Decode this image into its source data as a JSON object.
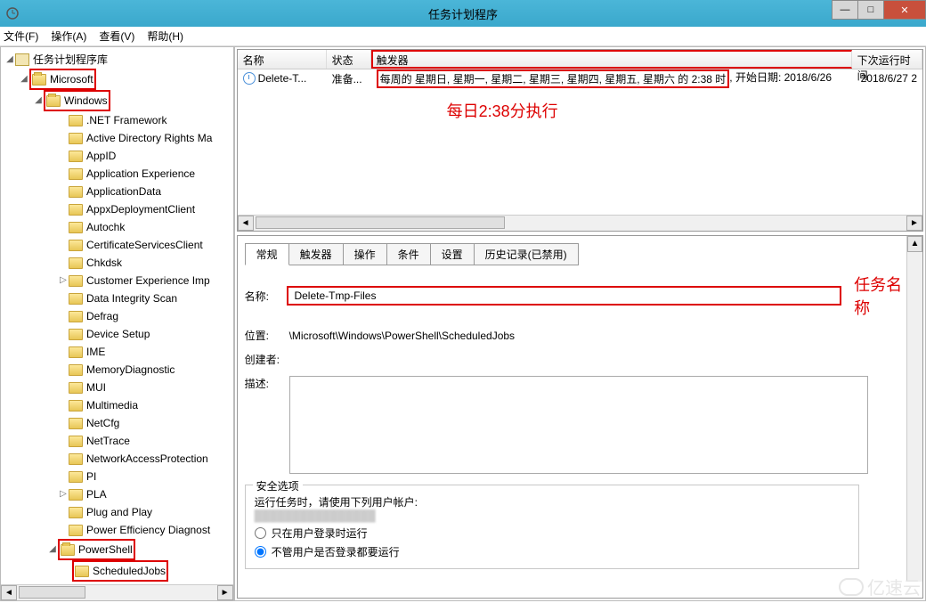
{
  "window": {
    "title": "任务计划程序"
  },
  "menu": {
    "file": "文件(F)",
    "action": "操作(A)",
    "view": "查看(V)",
    "help": "帮助(H)"
  },
  "tree": {
    "root": "任务计划程序库",
    "microsoft": "Microsoft",
    "windows": "Windows",
    "items": [
      ".NET Framework",
      "Active Directory Rights Ma",
      "AppID",
      "Application Experience",
      "ApplicationData",
      "AppxDeploymentClient",
      "Autochk",
      "CertificateServicesClient",
      "Chkdsk",
      "Customer Experience Imp",
      "Data Integrity Scan",
      "Defrag",
      "Device Setup",
      "IME",
      "MemoryDiagnostic",
      "MUI",
      "Multimedia",
      "NetCfg",
      "NetTrace",
      "NetworkAccessProtection",
      "PI",
      "PLA",
      "Plug and Play",
      "Power Efficiency Diagnost"
    ],
    "powershell": "PowerShell",
    "scheduledjobs": "ScheduledJobs"
  },
  "list": {
    "headers": {
      "name": "名称",
      "status": "状态",
      "trigger": "触发器",
      "next": "下次运行时间"
    },
    "row": {
      "name": "Delete-T...",
      "status": "准备...",
      "trigger": "每周的 星期日, 星期一, 星期二, 星期三, 星期四, 星期五, 星期六 的 2:38 时",
      "trigger_tail": ", 开始日期: 2018/6/26",
      "next": "2018/6/27 2"
    }
  },
  "annotations": {
    "daily": "每日2:38分执行",
    "taskname": "任务名称"
  },
  "tabs": {
    "general": "常规",
    "triggers": "触发器",
    "actions": "操作",
    "conditions": "条件",
    "settings": "设置",
    "history": "历史记录(已禁用)"
  },
  "form": {
    "name_label": "名称:",
    "name_value": "Delete-Tmp-Files",
    "location_label": "位置:",
    "location_value": "\\Microsoft\\Windows\\PowerShell\\ScheduledJobs",
    "creator_label": "创建者:",
    "desc_label": "描述:",
    "sec_legend": "安全选项",
    "sec_line": "运行任务时，请使用下列用户帐户:",
    "radio1": "只在用户登录时运行",
    "radio2": "不管用户是否登录都要运行"
  },
  "watermark": "亿速云"
}
